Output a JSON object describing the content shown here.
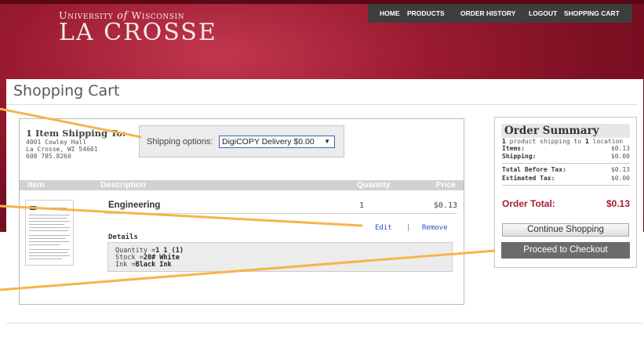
{
  "brand": {
    "line1_a": "University",
    "line1_of": "of",
    "line1_b": "Wisconsin",
    "line2": "LA CROSSE"
  },
  "nav": {
    "items": [
      "HOME",
      "PRODUCTS",
      "ORDER HISTORY",
      "LOGOUT",
      "SHOPPING CART"
    ]
  },
  "page": {
    "title": "Shopping Cart"
  },
  "cart": {
    "shipping_heading": "1 Item Shipping To:",
    "address": [
      "4001 Cowley Hall",
      "La Crosse, WI 54601",
      "608 785.8260"
    ],
    "shipping_options_label": "Shipping options:",
    "shipping_selected": "DigiCOPY Delivery $0.00",
    "columns": [
      "Item",
      "Description",
      "Quantity",
      "Price"
    ],
    "item": {
      "name": "Engineering",
      "quantity": "1",
      "price": "$0.13",
      "edit_label": "Edit",
      "separator": "|",
      "remove_label": "Remove",
      "details_heading": "Details",
      "details": [
        {
          "key": "Quantity =",
          "value": "1 1 (1)"
        },
        {
          "key": "Stock =",
          "value": "20# White"
        },
        {
          "key": "Ink =",
          "value": "Black Ink"
        }
      ]
    }
  },
  "summary": {
    "title": "Order Summary",
    "product_count": "1",
    "product_text_a": " product shipping to ",
    "location_count": "1",
    "product_text_b": " location",
    "rows": [
      {
        "label": "Items:",
        "value": "$0.13"
      },
      {
        "label": "Shipping:",
        "value": "$0.00"
      },
      {
        "label": "Total Before Tax:",
        "value": "$0.13"
      },
      {
        "label": "Estimated Tax:",
        "value": "$0.00"
      }
    ],
    "total_label": "Order Total:",
    "total_value": "$0.13",
    "continue_label": "Continue Shopping",
    "checkout_label": "Proceed to Checkout"
  },
  "colors": {
    "header_red": "#9a1b31",
    "nav_bg": "#3e3e3e",
    "accent_orange": "#f6b44b",
    "total_red": "#a21e35",
    "link_blue": "#2a4fc9"
  }
}
